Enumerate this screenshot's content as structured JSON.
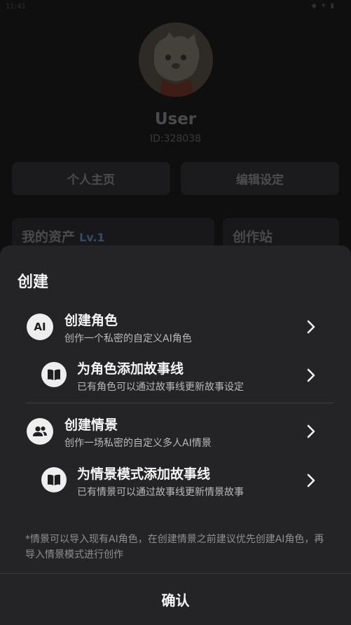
{
  "status_bar": {
    "time": "11:41",
    "icons": "◆ ▾ ▮"
  },
  "profile": {
    "username": "User",
    "user_id": "ID:328038",
    "homepage_button": "个人主页",
    "edit_settings_button": "编辑设定",
    "assets_card": {
      "title": "我的资产",
      "level": "Lv.1"
    },
    "studio_card": {
      "title": "创作站"
    }
  },
  "sheet": {
    "title": "创建",
    "items": [
      {
        "icon": "ai-badge-icon",
        "icon_text": "AI",
        "title": "创建角色",
        "desc": "创作一个私密的自定义AI角色"
      },
      {
        "icon": "book-icon",
        "title": "为角色添加故事线",
        "desc": "已有角色可以通过故事线更新故事设定"
      },
      {
        "icon": "group-icon",
        "title": "创建情景",
        "desc": "创作一场私密的自定义多人AI情景"
      },
      {
        "icon": "book-icon",
        "title": "为情景模式添加故事线",
        "desc": "已有情景可以通过故事线更新情景故事"
      }
    ],
    "note": "*情景可以导入现有AI角色，在创建情景之前建议优先创建AI角色，再导入情景模式进行创作",
    "confirm_label": "确认"
  },
  "colors": {
    "overlay_bg": "#0f0f10",
    "sheet_bg": "#242426",
    "icon_bg": "#eeeeee",
    "text_primary": "#f4f4f4",
    "text_secondary": "#b9b9bb"
  }
}
